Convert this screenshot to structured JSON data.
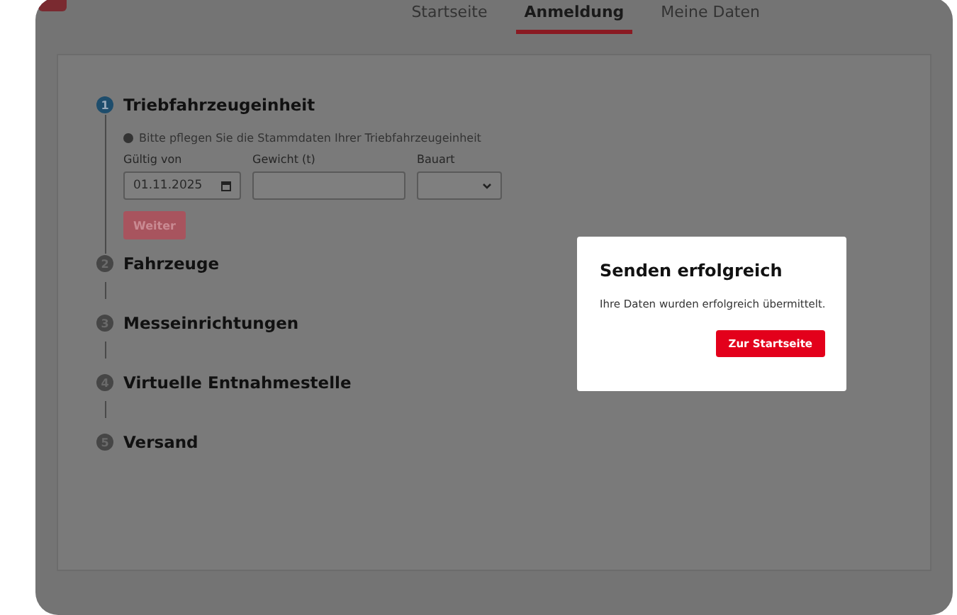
{
  "header": {
    "nav": [
      {
        "label": "Startseite",
        "selected": false
      },
      {
        "label": "Anmeldung",
        "selected": true
      },
      {
        "label": "Meine Daten",
        "selected": false
      }
    ]
  },
  "steps": [
    {
      "number": "1",
      "title": "Triebfahrzeugeinheit",
      "active": true,
      "form": {
        "info": "Bitte pflegen Sie die Stammdaten Ihrer Triebfahrzeugeinheit",
        "fields": [
          {
            "kind": "date",
            "label": "Gültig von",
            "value": "01.11.2025"
          },
          {
            "kind": "text",
            "label": "Gewicht (t)"
          },
          {
            "kind": "select",
            "label": "Bauart"
          }
        ],
        "button": {
          "label": "Weiter",
          "disabled": true
        }
      }
    },
    {
      "number": "2",
      "title": "Fahrzeuge",
      "active": false
    },
    {
      "number": "3",
      "title": "Messeinrichtungen",
      "active": false
    },
    {
      "number": "4",
      "title": "Virtuelle Entnahmestelle",
      "active": false
    },
    {
      "number": "5",
      "title": "Versand",
      "active": false
    }
  ],
  "dialog": {
    "title": "Senden erfolgreich",
    "message": "Ihre Daten wurden erfolgreich übermittelt.",
    "button": "Zur Startseite"
  }
}
